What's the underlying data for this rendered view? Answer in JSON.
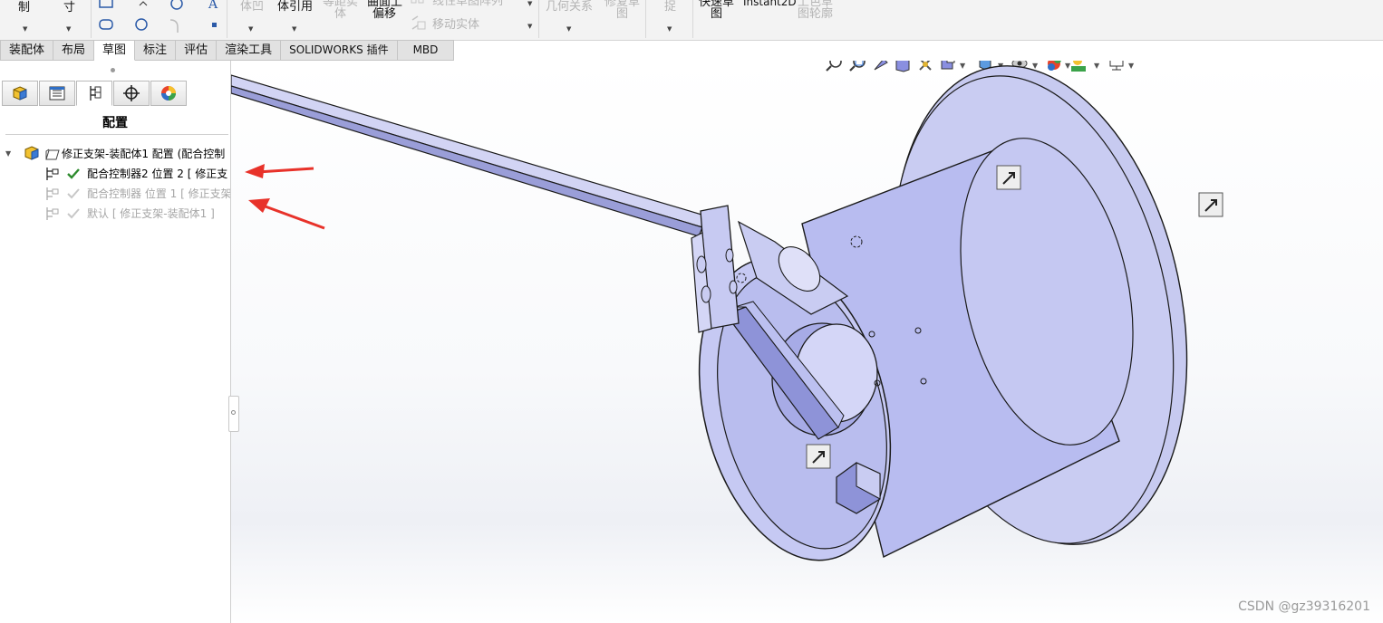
{
  "ribbon": {
    "items": [
      {
        "id": "zhi",
        "text": "制",
        "enabled": true
      },
      {
        "id": "cun",
        "text": "寸",
        "enabled": true
      },
      {
        "id": "ti_dis",
        "text": "体凹",
        "enabled": false
      },
      {
        "id": "ti_yin",
        "text": "体引用",
        "enabled": true
      },
      {
        "id": "deng1",
        "text": "等距实",
        "enabled": false
      },
      {
        "id": "deng2",
        "text": "体",
        "enabled": false
      },
      {
        "id": "qu1",
        "text": "曲面上",
        "enabled": true
      },
      {
        "id": "qu2",
        "text": "偏移",
        "enabled": true
      },
      {
        "id": "xian",
        "text": "线性草图阵列",
        "enabled": false
      },
      {
        "id": "yi",
        "text": "移动实体",
        "enabled": false
      },
      {
        "id": "ji",
        "text": "几何关系",
        "enabled": false
      },
      {
        "id": "xiu1",
        "text": "修复草",
        "enabled": false
      },
      {
        "id": "xiu2",
        "text": "图",
        "enabled": false
      },
      {
        "id": "zhuo",
        "text": "捉",
        "enabled": false
      },
      {
        "id": "kuai1",
        "text": "快速草",
        "enabled": true
      },
      {
        "id": "kuai2",
        "text": "图",
        "enabled": true
      },
      {
        "id": "inst",
        "text": "Instant2D",
        "enabled": true
      },
      {
        "id": "shang1",
        "text": "上色草",
        "enabled": false
      },
      {
        "id": "shang2",
        "text": "图轮廓",
        "enabled": false
      }
    ]
  },
  "tabs": [
    {
      "label": "装配体",
      "active": false
    },
    {
      "label": "布局",
      "active": false
    },
    {
      "label": "草图",
      "active": true
    },
    {
      "label": "标注",
      "active": false
    },
    {
      "label": "评估",
      "active": false
    },
    {
      "label": "渲染工具",
      "active": false
    },
    {
      "label": "SOLIDWORKS 插件",
      "active": false
    },
    {
      "label": "MBD",
      "active": false
    }
  ],
  "panel": {
    "tab_icons": [
      "feature-manager-icon",
      "property-manager-icon",
      "configuration-manager-icon",
      "dimxpert-icon",
      "display-manager-icon"
    ],
    "title": "配置",
    "tree": [
      {
        "text": "修正支架-装配体1 配置  (配合控制",
        "state": "root"
      },
      {
        "text": "配合控制器2 位置 2 [ 修正支",
        "state": "active"
      },
      {
        "text": "配合控制器 位置 1 [ 修正支架",
        "state": "inactive"
      },
      {
        "text": "默认 [ 修正支架-装配体1 ]",
        "state": "inactive"
      }
    ]
  },
  "hud_icons": [
    "zoom-to-fit-icon",
    "zoom-to-area-icon",
    "previous-view-icon",
    "section-view-icon",
    "dynamic-annotation-icon",
    "view-orientation-icon",
    "display-style-icon",
    "hide-show-icon",
    "edit-appearance-icon",
    "apply-scene-icon",
    "view-settings-icon"
  ],
  "colors": {
    "part_fill": "#c9ccf2",
    "part_dark": "#a4a8e6",
    "edge": "#1a1a1a",
    "arrow": "#e8322a"
  },
  "watermark": "CSDN @gz39316201"
}
